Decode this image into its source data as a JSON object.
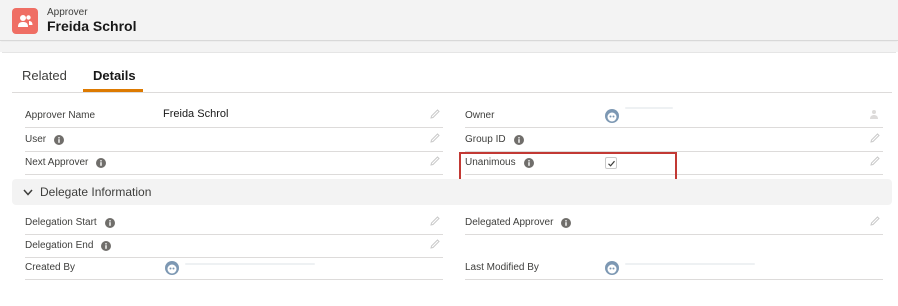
{
  "header": {
    "object_type": "Approver",
    "record_name": "Freida Schrol",
    "icon": "user-group-icon",
    "icon_color": "#ef6e64"
  },
  "tabs": [
    {
      "label": "Related",
      "active": false
    },
    {
      "label": "Details",
      "active": true
    }
  ],
  "accent_color": "#dd7a01",
  "fields": {
    "approver_name": {
      "label": "Approver Name",
      "value": "Freida Schrol"
    },
    "owner": {
      "label": "Owner"
    },
    "user": {
      "label": "User"
    },
    "group_id": {
      "label": "Group ID"
    },
    "next_approver": {
      "label": "Next Approver"
    },
    "unanimous": {
      "label": "Unanimous",
      "checked": true
    }
  },
  "section": {
    "title": "Delegate Information",
    "expanded": true,
    "fields": {
      "delegation_start": {
        "label": "Delegation Start"
      },
      "delegated_approver": {
        "label": "Delegated Approver"
      },
      "delegation_end": {
        "label": "Delegation End"
      },
      "created_by": {
        "label": "Created By"
      },
      "last_modified_by": {
        "label": "Last Modified By"
      }
    }
  },
  "highlight_color": "#c23934"
}
